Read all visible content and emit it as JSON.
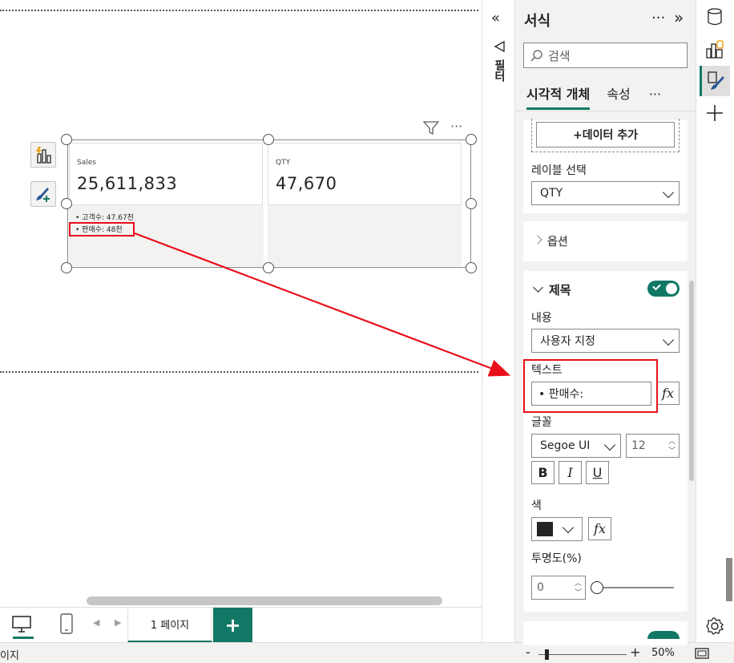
{
  "card": {
    "tiles": [
      {
        "label": "Sales",
        "value": "25,611,833"
      },
      {
        "label": "QTY",
        "value": "47,670"
      }
    ],
    "reference_lines": [
      "• 고객수: 47.67천",
      "• 판매수: 48천"
    ]
  },
  "page_tabs": {
    "page_label": "1 페이지",
    "add_label": "+"
  },
  "status": {
    "left_text": "이지",
    "zoom_minus": "-",
    "zoom_plus": "+",
    "zoom": "50%"
  },
  "filter_strip": {
    "label": "필터"
  },
  "format_pane": {
    "title": "서식",
    "more": "···",
    "collapse": "»",
    "search_placeholder": "검색",
    "tabs": [
      "시각적 개체",
      "속성"
    ],
    "tabs_more": "···",
    "add_data_button": "+데이터 추가",
    "label_select_title": "레이블 선택",
    "label_select_value": "QTY",
    "options_section": "옵션",
    "title_section": "제목",
    "content_label": "내용",
    "content_value": "사용자 지정",
    "text_label": "텍스트",
    "text_value": "• 판매수:",
    "fx_label": "fx",
    "font_label": "글꼴",
    "font_family": "Segoe UI",
    "font_size": "12",
    "bold": "B",
    "italic": "I",
    "underline": "U",
    "color_label": "색",
    "transparency_label": "투명도(%)",
    "transparency_value": "0"
  },
  "colors": {
    "accent": "#117865",
    "annotation": "#e8101a"
  }
}
